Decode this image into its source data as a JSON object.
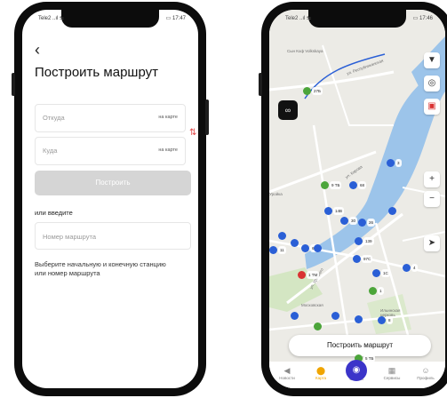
{
  "left_phone": {
    "status": {
      "carrier": "Tele2 ..ıl ⇆",
      "time": "▭ 17:47"
    },
    "back": "‹",
    "title": "Построить маршрут",
    "from": {
      "placeholder": "Откуда",
      "map_chip": "на карте"
    },
    "to": {
      "placeholder": "Куда",
      "map_chip": "на карте"
    },
    "swap": "⇅",
    "build_button": "Построить",
    "or_enter": "или введите",
    "route_number": {
      "placeholder": "Номер маршрута"
    },
    "hint": "Выберите начальную и конечную станцию или номер маршрута"
  },
  "right_phone": {
    "status": {
      "carrier": "Tele2 ..ıl ⇆",
      "time": "▭ 17:46"
    },
    "colors": {
      "bus_blue": "#2a5fd6",
      "trolley_green": "#4ca53a",
      "tram_red": "#d93333",
      "river": "#9cc4ea",
      "accent": "#f0a500",
      "pay": "#3b34c9"
    },
    "map_labels": [
      "Сын Коф Volkskaya",
      "ул. Республиканская",
      "Уройка",
      "Ильинская церковь",
      "ул. Кирова",
      "ул. Урицкого",
      "Московская"
    ],
    "vehicles": [
      {
        "type": "trolley",
        "label": "27Б"
      },
      {
        "type": "bus",
        "label": "3"
      },
      {
        "type": "trolley",
        "label": "9 ТБ"
      },
      {
        "type": "bus",
        "label": "68"
      },
      {
        "type": "bus",
        "label": "14В"
      },
      {
        "type": "bus",
        "label": "30"
      },
      {
        "type": "bus",
        "label": "26"
      },
      {
        "type": "bus",
        "label": "139"
      },
      {
        "type": "bus",
        "label": "66"
      },
      {
        "type": "bus",
        "label": "11"
      },
      {
        "type": "bus",
        "label": "97С"
      },
      {
        "type": "bus",
        "label": "4"
      },
      {
        "type": "tram",
        "label": "1 ТМ"
      },
      {
        "type": "bus",
        "label": "8"
      },
      {
        "type": "trolley",
        "label": "5 ТБ"
      },
      {
        "type": "bus",
        "label": "1С"
      },
      {
        "type": "trolley",
        "label": "1"
      }
    ],
    "controls": {
      "filter": "▼",
      "locate": "◎",
      "transport": "▣",
      "zoom_in": "+",
      "zoom_out": "−",
      "navigate": "➤",
      "glasses": "∞"
    },
    "build_route_button": "Построить маршрут",
    "tabs": [
      {
        "icon": "◀",
        "label": "Новости",
        "active": false
      },
      {
        "icon": "⬤",
        "label": "Карта",
        "active": true
      },
      {
        "icon": "◉",
        "label": "Оплата",
        "active": false
      },
      {
        "icon": "▦",
        "label": "Сервисы",
        "active": false
      },
      {
        "icon": "☺",
        "label": "Профиль",
        "active": false
      }
    ]
  }
}
